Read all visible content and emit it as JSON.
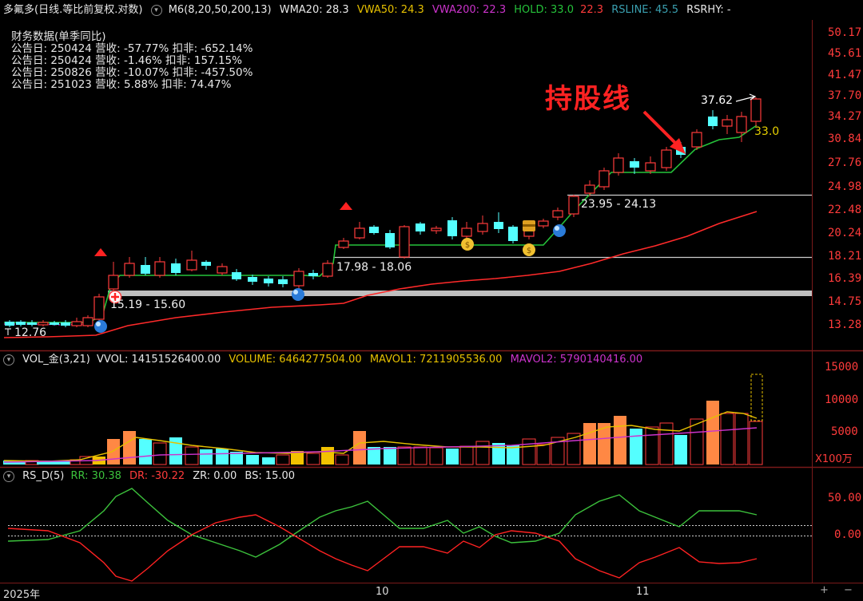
{
  "main_header": {
    "title": "多氟多(日线.等比前复权.对数)",
    "indicator_name": "M6(8,20,50,200,13)",
    "wma20": "WMA20: 28.3",
    "vwa50": "VWA50: 24.3",
    "vwa200": "VWA200: 22.3",
    "hold": "HOLD: 33.0",
    "hold_value2": "22.3",
    "rsline": "RSLINE: 45.5",
    "rsrhy": "RSRHY: -"
  },
  "financials": {
    "title": "财务数据(单季同比)",
    "rows": [
      "公告日: 250424  营收: -57.77%   扣非: -652.14%",
      "公告日: 250424  营收: -1.46%   扣非: 157.15%",
      "公告日: 250826  营收: -10.07%   扣非: -457.50%",
      "公告日: 251023  营收: 5.88%   扣非: 74.47%"
    ]
  },
  "annotations": {
    "hold_line_text": "持股线",
    "price_high": "37.62",
    "hold_label": "33.0",
    "range1": "23.95 - 24.13",
    "range2": "17.98 - 18.06",
    "range3": "15.19 - 15.60",
    "low_label": "12.76"
  },
  "price_axis": [
    "50.17",
    "45.61",
    "41.47",
    "37.70",
    "34.27",
    "30.84",
    "27.76",
    "24.98",
    "22.48",
    "20.24",
    "18.21",
    "16.39",
    "14.75",
    "13.28"
  ],
  "volume_header": {
    "name": "VOL_金(3,21)",
    "vvol": "VVOL: 14151526400.00",
    "volume": "VOLUME: 6464277504.00",
    "mavol1": "MAVOL1: 7211905536.00",
    "mavol2": "MAVOL2: 5790140416.00"
  },
  "volume_axis": [
    "15000",
    "10000",
    "5000"
  ],
  "volume_unit": "X100万",
  "rs_header": {
    "name": "RS_D(5)",
    "rr": "RR: 30.38",
    "dr": "DR: -30.22",
    "zr": "ZR: 0.00",
    "bs": "BS: 15.00"
  },
  "rs_axis": [
    "50.00",
    "0.00"
  ],
  "time_axis": {
    "year": "2025年",
    "m10": "10",
    "m11": "11"
  },
  "controls": {
    "plus": "+",
    "minus": "−"
  },
  "colors": {
    "up": "#ff3b3b",
    "down": "#54ffff",
    "hold": "#25c23a",
    "vwa50": "#e6c000",
    "vwa200": "#cc33cc",
    "rsline": "#3aa0b0",
    "orange": "#ff8844"
  }
}
